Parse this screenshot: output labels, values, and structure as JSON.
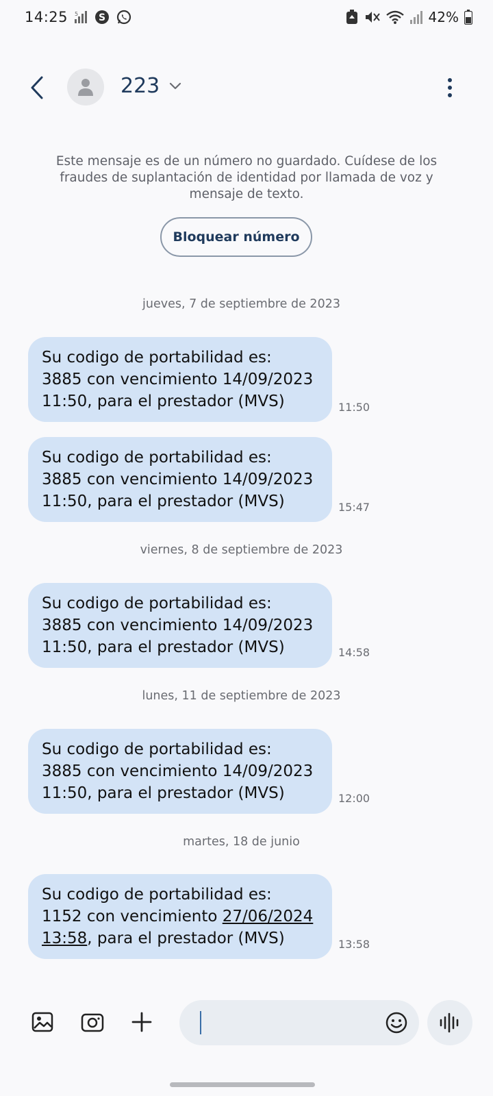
{
  "status_bar": {
    "time": "14:25",
    "battery": "42%"
  },
  "header": {
    "contact": "223"
  },
  "notice": {
    "text": "Este mensaje es de un número no guardado. Cuídese de los fraudes de suplantación de identidad por llamada de voz y mensaje de texto.",
    "block_label": "Bloquear número"
  },
  "dates": [
    "jueves, 7 de septiembre de 2023",
    "viernes, 8 de septiembre de 2023",
    "lunes, 11 de septiembre de 2023",
    "martes, 18 de junio"
  ],
  "messages": [
    {
      "lines": [
        "Su codigo de portabilidad es:",
        "3885 con vencimiento 14/09/2023",
        "11:50, para el prestador (MVS)"
      ],
      "time": "11:50"
    },
    {
      "lines": [
        "Su codigo de portabilidad es:",
        "3885 con vencimiento 14/09/2023",
        "11:50, para el prestador (MVS)"
      ],
      "time": "15:47"
    },
    {
      "lines": [
        "Su codigo de portabilidad es:",
        "3885 con vencimiento 14/09/2023",
        "11:50, para el prestador (MVS)"
      ],
      "time": "14:58"
    },
    {
      "lines": [
        "Su codigo de portabilidad es:",
        "3885 con vencimiento 14/09/2023",
        "11:50, para el prestador (MVS)"
      ],
      "time": "12:00"
    },
    {
      "line1": "Su codigo de portabilidad es:",
      "line2_text": "1152 con vencimiento ",
      "line2_link": "27/06/2024",
      "line3_link": "13:58",
      "line3_text": ", para el prestador (MVS)",
      "time": "13:58"
    }
  ],
  "composer": {
    "value": ""
  },
  "colors": {
    "bubble": "#d3e3f6",
    "accent": "#1f3a5c",
    "background": "#f9f9fb"
  }
}
